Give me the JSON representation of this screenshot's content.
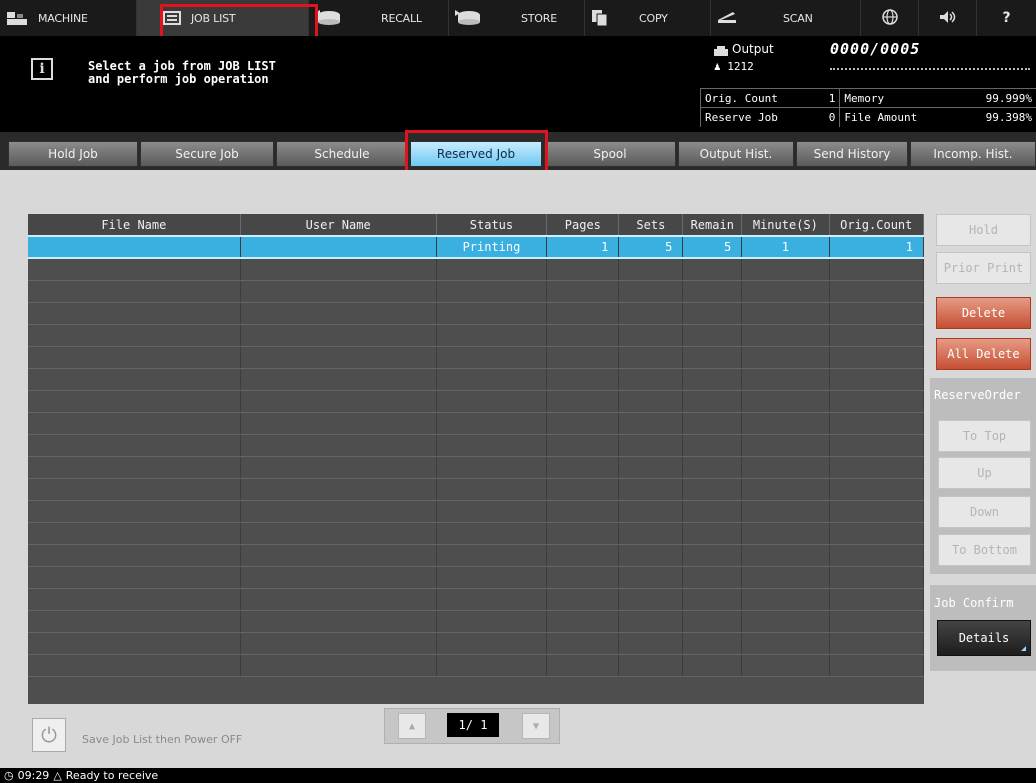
{
  "menu": {
    "tabs": [
      {
        "id": "machine",
        "label": "MACHINE",
        "icon": "machine-icon"
      },
      {
        "id": "joblist",
        "label": "JOB LIST",
        "icon": "job-list-icon"
      },
      {
        "id": "recall",
        "label": "RECALL",
        "icon": "recall-icon"
      },
      {
        "id": "store",
        "label": "STORE",
        "icon": "store-icon"
      },
      {
        "id": "copy",
        "label": "COPY",
        "icon": "copy-icon"
      },
      {
        "id": "scan",
        "label": "SCAN",
        "icon": "scan-icon"
      }
    ],
    "selected": "JOB LIST"
  },
  "message": {
    "line1": "Select a job from JOB LIST",
    "line2": "and perform job operation"
  },
  "status": {
    "output_label": "Output",
    "output_value": "0000/0005",
    "user": "1212",
    "orig_count_label": "Orig. Count",
    "orig_count_value": "1",
    "memory_label": "Memory",
    "memory_value": "99.999%",
    "reserve_job_label": "Reserve Job",
    "reserve_job_value": "0",
    "file_amount_label": "File Amount",
    "file_amount_value": "99.398%"
  },
  "job_tabs": [
    "Hold Job",
    "Secure Job",
    "Schedule",
    "Reserved Job",
    "Spool",
    "Output Hist.",
    "Send History",
    "Incomp. Hist."
  ],
  "active_job_tab": "Reserved Job",
  "table": {
    "columns": [
      "File Name",
      "User Name",
      "Status",
      "Pages",
      "Sets",
      "Remain",
      "Minute(S)",
      "Orig.Count"
    ],
    "rows": [
      {
        "file_name": "",
        "user_name": "",
        "status": "Printing",
        "pages": "1",
        "sets": "5",
        "remain": "5",
        "minutes": "1",
        "orig_count": "1"
      }
    ]
  },
  "side": {
    "hold": "Hold",
    "prior_print": "Prior Print",
    "delete": "Delete",
    "all_delete": "All Delete",
    "reserve_order_label": "ReserveOrder",
    "to_top": "To Top",
    "up": "Up",
    "down": "Down",
    "to_bottom": "To Bottom",
    "job_confirm_label": "Job Confirm",
    "details": "Details"
  },
  "bottom": {
    "power_label": "Save Job List then Power OFF",
    "page": "1/ 1"
  },
  "statusbar": {
    "time": "09:29",
    "text": "Ready to receive"
  },
  "colors": {
    "highlight": "#e0141e",
    "selected_row": "#3ab0e0",
    "active_tab": "#6fc8f2",
    "delete_button": "#c54f32"
  }
}
